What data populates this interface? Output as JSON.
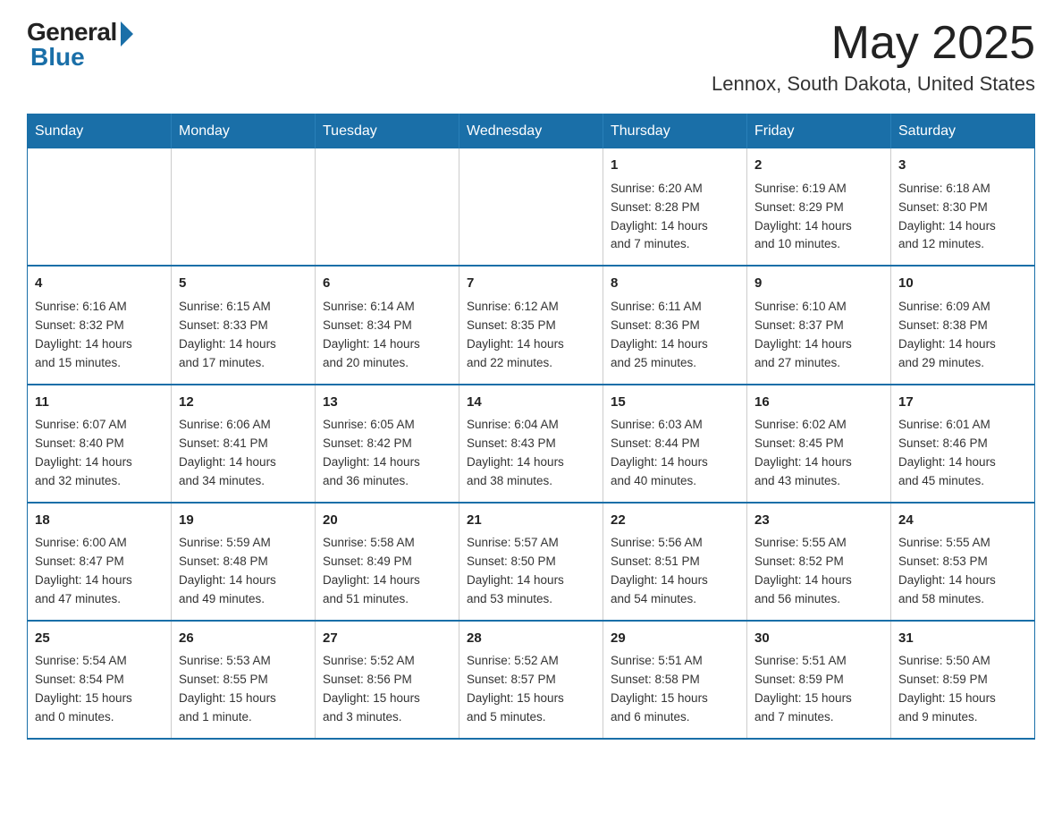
{
  "header": {
    "logo_general": "General",
    "logo_blue": "Blue",
    "month": "May 2025",
    "location": "Lennox, South Dakota, United States"
  },
  "calendar": {
    "days_of_week": [
      "Sunday",
      "Monday",
      "Tuesday",
      "Wednesday",
      "Thursday",
      "Friday",
      "Saturday"
    ],
    "weeks": [
      [
        {
          "day": "",
          "info": ""
        },
        {
          "day": "",
          "info": ""
        },
        {
          "day": "",
          "info": ""
        },
        {
          "day": "",
          "info": ""
        },
        {
          "day": "1",
          "info": "Sunrise: 6:20 AM\nSunset: 8:28 PM\nDaylight: 14 hours\nand 7 minutes."
        },
        {
          "day": "2",
          "info": "Sunrise: 6:19 AM\nSunset: 8:29 PM\nDaylight: 14 hours\nand 10 minutes."
        },
        {
          "day": "3",
          "info": "Sunrise: 6:18 AM\nSunset: 8:30 PM\nDaylight: 14 hours\nand 12 minutes."
        }
      ],
      [
        {
          "day": "4",
          "info": "Sunrise: 6:16 AM\nSunset: 8:32 PM\nDaylight: 14 hours\nand 15 minutes."
        },
        {
          "day": "5",
          "info": "Sunrise: 6:15 AM\nSunset: 8:33 PM\nDaylight: 14 hours\nand 17 minutes."
        },
        {
          "day": "6",
          "info": "Sunrise: 6:14 AM\nSunset: 8:34 PM\nDaylight: 14 hours\nand 20 minutes."
        },
        {
          "day": "7",
          "info": "Sunrise: 6:12 AM\nSunset: 8:35 PM\nDaylight: 14 hours\nand 22 minutes."
        },
        {
          "day": "8",
          "info": "Sunrise: 6:11 AM\nSunset: 8:36 PM\nDaylight: 14 hours\nand 25 minutes."
        },
        {
          "day": "9",
          "info": "Sunrise: 6:10 AM\nSunset: 8:37 PM\nDaylight: 14 hours\nand 27 minutes."
        },
        {
          "day": "10",
          "info": "Sunrise: 6:09 AM\nSunset: 8:38 PM\nDaylight: 14 hours\nand 29 minutes."
        }
      ],
      [
        {
          "day": "11",
          "info": "Sunrise: 6:07 AM\nSunset: 8:40 PM\nDaylight: 14 hours\nand 32 minutes."
        },
        {
          "day": "12",
          "info": "Sunrise: 6:06 AM\nSunset: 8:41 PM\nDaylight: 14 hours\nand 34 minutes."
        },
        {
          "day": "13",
          "info": "Sunrise: 6:05 AM\nSunset: 8:42 PM\nDaylight: 14 hours\nand 36 minutes."
        },
        {
          "day": "14",
          "info": "Sunrise: 6:04 AM\nSunset: 8:43 PM\nDaylight: 14 hours\nand 38 minutes."
        },
        {
          "day": "15",
          "info": "Sunrise: 6:03 AM\nSunset: 8:44 PM\nDaylight: 14 hours\nand 40 minutes."
        },
        {
          "day": "16",
          "info": "Sunrise: 6:02 AM\nSunset: 8:45 PM\nDaylight: 14 hours\nand 43 minutes."
        },
        {
          "day": "17",
          "info": "Sunrise: 6:01 AM\nSunset: 8:46 PM\nDaylight: 14 hours\nand 45 minutes."
        }
      ],
      [
        {
          "day": "18",
          "info": "Sunrise: 6:00 AM\nSunset: 8:47 PM\nDaylight: 14 hours\nand 47 minutes."
        },
        {
          "day": "19",
          "info": "Sunrise: 5:59 AM\nSunset: 8:48 PM\nDaylight: 14 hours\nand 49 minutes."
        },
        {
          "day": "20",
          "info": "Sunrise: 5:58 AM\nSunset: 8:49 PM\nDaylight: 14 hours\nand 51 minutes."
        },
        {
          "day": "21",
          "info": "Sunrise: 5:57 AM\nSunset: 8:50 PM\nDaylight: 14 hours\nand 53 minutes."
        },
        {
          "day": "22",
          "info": "Sunrise: 5:56 AM\nSunset: 8:51 PM\nDaylight: 14 hours\nand 54 minutes."
        },
        {
          "day": "23",
          "info": "Sunrise: 5:55 AM\nSunset: 8:52 PM\nDaylight: 14 hours\nand 56 minutes."
        },
        {
          "day": "24",
          "info": "Sunrise: 5:55 AM\nSunset: 8:53 PM\nDaylight: 14 hours\nand 58 minutes."
        }
      ],
      [
        {
          "day": "25",
          "info": "Sunrise: 5:54 AM\nSunset: 8:54 PM\nDaylight: 15 hours\nand 0 minutes."
        },
        {
          "day": "26",
          "info": "Sunrise: 5:53 AM\nSunset: 8:55 PM\nDaylight: 15 hours\nand 1 minute."
        },
        {
          "day": "27",
          "info": "Sunrise: 5:52 AM\nSunset: 8:56 PM\nDaylight: 15 hours\nand 3 minutes."
        },
        {
          "day": "28",
          "info": "Sunrise: 5:52 AM\nSunset: 8:57 PM\nDaylight: 15 hours\nand 5 minutes."
        },
        {
          "day": "29",
          "info": "Sunrise: 5:51 AM\nSunset: 8:58 PM\nDaylight: 15 hours\nand 6 minutes."
        },
        {
          "day": "30",
          "info": "Sunrise: 5:51 AM\nSunset: 8:59 PM\nDaylight: 15 hours\nand 7 minutes."
        },
        {
          "day": "31",
          "info": "Sunrise: 5:50 AM\nSunset: 8:59 PM\nDaylight: 15 hours\nand 9 minutes."
        }
      ]
    ]
  }
}
